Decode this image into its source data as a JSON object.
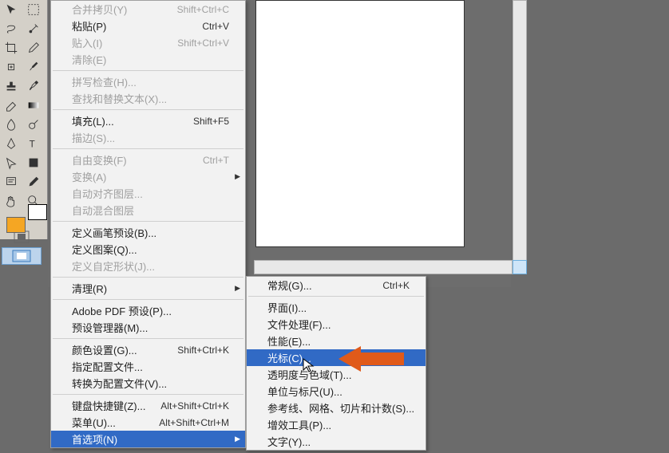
{
  "toolbox": {
    "tools": [
      [
        "move-tool",
        "marquee-tool"
      ],
      [
        "lasso-tool",
        "wand-tool"
      ],
      [
        "crop-tool",
        "slice-tool"
      ],
      [
        "eyedropper-tool",
        "patch-tool"
      ],
      [
        "brush-tool",
        "stamp-tool"
      ],
      [
        "history-tool",
        "eraser-tool"
      ],
      [
        "gradient-tool",
        "blur-tool"
      ],
      [
        "dodge-tool",
        "pen-tool"
      ],
      [
        "type-tool",
        "path-tool"
      ],
      [
        "shape-tool",
        "notes-tool"
      ],
      [
        "hand-tool",
        "zoom-tool"
      ]
    ],
    "fg_color": "#f5a623",
    "bg_color": "#ffffff"
  },
  "menu_main": [
    {
      "label": "合并拷贝(Y)",
      "shortcut": "Shift+Ctrl+C",
      "disabled": true
    },
    {
      "label": "粘贴(P)",
      "shortcut": "Ctrl+V"
    },
    {
      "label": "贴入(I)",
      "shortcut": "Shift+Ctrl+V",
      "disabled": true
    },
    {
      "label": "清除(E)",
      "disabled": true
    },
    {
      "sep": true
    },
    {
      "label": "拼写检查(H)...",
      "disabled": true
    },
    {
      "label": "查找和替换文本(X)...",
      "disabled": true
    },
    {
      "sep": true
    },
    {
      "label": "填充(L)...",
      "shortcut": "Shift+F5"
    },
    {
      "label": "描边(S)...",
      "disabled": true
    },
    {
      "sep": true
    },
    {
      "label": "自由变换(F)",
      "shortcut": "Ctrl+T",
      "disabled": true
    },
    {
      "label": "变换(A)",
      "disabled": true,
      "arrow": true
    },
    {
      "label": "自动对齐图层...",
      "disabled": true
    },
    {
      "label": "自动混合图层",
      "disabled": true
    },
    {
      "sep": true
    },
    {
      "label": "定义画笔预设(B)..."
    },
    {
      "label": "定义图案(Q)..."
    },
    {
      "label": "定义自定形状(J)...",
      "disabled": true
    },
    {
      "sep": true
    },
    {
      "label": "清理(R)",
      "arrow": true
    },
    {
      "sep": true
    },
    {
      "label": "Adobe PDF 预设(P)..."
    },
    {
      "label": "预设管理器(M)..."
    },
    {
      "sep": true
    },
    {
      "label": "颜色设置(G)...",
      "shortcut": "Shift+Ctrl+K"
    },
    {
      "label": "指定配置文件..."
    },
    {
      "label": "转换为配置文件(V)..."
    },
    {
      "sep": true
    },
    {
      "label": "键盘快捷键(Z)...",
      "shortcut": "Alt+Shift+Ctrl+K"
    },
    {
      "label": "菜单(U)...",
      "shortcut": "Alt+Shift+Ctrl+M"
    },
    {
      "label": "首选项(N)",
      "arrow": true,
      "hl": true
    }
  ],
  "menu_sub": [
    {
      "label": "常规(G)...",
      "shortcut": "Ctrl+K"
    },
    {
      "sep": true
    },
    {
      "label": "界面(I)..."
    },
    {
      "label": "文件处理(F)..."
    },
    {
      "label": "性能(E)..."
    },
    {
      "label": "光标(C)...",
      "hl": true
    },
    {
      "label": "透明度与色域(T)..."
    },
    {
      "label": "单位与标尺(U)..."
    },
    {
      "label": "参考线、网格、切片和计数(S)..."
    },
    {
      "label": "增效工具(P)..."
    },
    {
      "label": "文字(Y)..."
    }
  ],
  "annotation_color": "#e05a1a"
}
